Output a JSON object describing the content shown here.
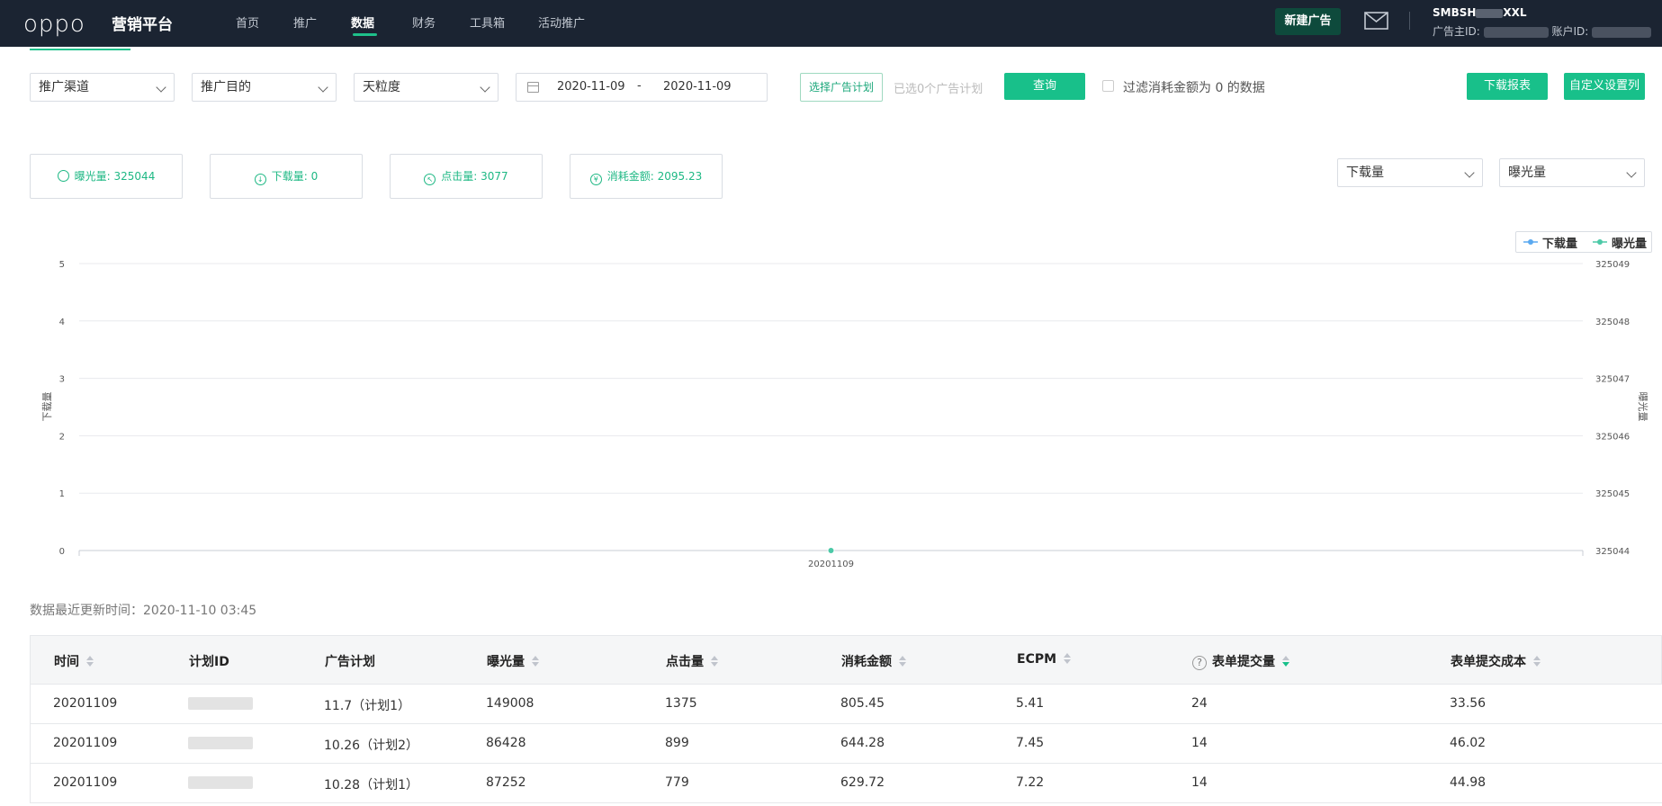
{
  "nav": {
    "logo": "oppo",
    "platform": "营销平台",
    "items": [
      "首页",
      "推广",
      "数据",
      "财务",
      "工具箱",
      "活动推广"
    ],
    "active": "数据",
    "new_ad": "新建广告",
    "account_name_prefix": "SMBSH",
    "account_name_suffix": "XXL",
    "advertiser_id_label": "广告主ID:",
    "account_id_label": "账户ID:"
  },
  "filters": {
    "channel": "推广渠道",
    "purpose": "推广目的",
    "granularity": "天粒度",
    "date_start": "2020-11-09",
    "date_sep": "-",
    "date_end": "2020-11-09",
    "select_plan": "选择广告计划",
    "plan_count": "已选0个广告计划",
    "query": "查询",
    "filter_zero": "过滤消耗金额为 0 的数据",
    "download": "下载报表",
    "custom_columns": "自定义设置列"
  },
  "metrics": {
    "impressions": "曝光量: 325044",
    "downloads": "下载量: 0",
    "clicks": "点击量: 3077",
    "spend": "消耗金额: 2095.23"
  },
  "chart_selectors": {
    "left": "下载量",
    "right": "曝光量"
  },
  "chart_data": {
    "type": "line",
    "x": [
      "20201109"
    ],
    "series": [
      {
        "name": "下载量",
        "axis": "left",
        "values": [
          0
        ],
        "color": "#5aa9f0"
      },
      {
        "name": "曝光量",
        "axis": "right",
        "values": [
          325044
        ],
        "color": "#4cc9a7"
      }
    ],
    "ylabel": "下载量",
    "ylabel_right": "曝光量",
    "ylim": [
      0,
      5
    ],
    "ylim_right": [
      325044,
      325049
    ],
    "yticks": [
      "0",
      "1",
      "2",
      "3",
      "4",
      "5"
    ],
    "yticks_right": [
      "325044",
      "325045",
      "325046",
      "325047",
      "325048",
      "325049"
    ],
    "legend": "top-right",
    "grid": true
  },
  "update_time": "数据最近更新时间：2020-11-10 03:45",
  "table": {
    "columns": [
      "时间",
      "计划ID",
      "广告计划",
      "曝光量",
      "点击量",
      "消耗金额",
      "ECPM",
      "表单提交量",
      "表单提交成本"
    ],
    "help_icon": "?",
    "rows": [
      [
        "20201109",
        "",
        "11.7（计划1）",
        "149008",
        "1375",
        "805.45",
        "5.41",
        "24",
        "33.56"
      ],
      [
        "20201109",
        "",
        "10.26（计划2）",
        "86428",
        "899",
        "644.28",
        "7.45",
        "14",
        "46.02"
      ],
      [
        "20201109",
        "",
        "10.28（计划1）",
        "87252",
        "779",
        "629.72",
        "7.22",
        "14",
        "44.98"
      ]
    ]
  },
  "colors": {
    "accent": "#18c08a",
    "nav_bg": "#1b2432"
  }
}
